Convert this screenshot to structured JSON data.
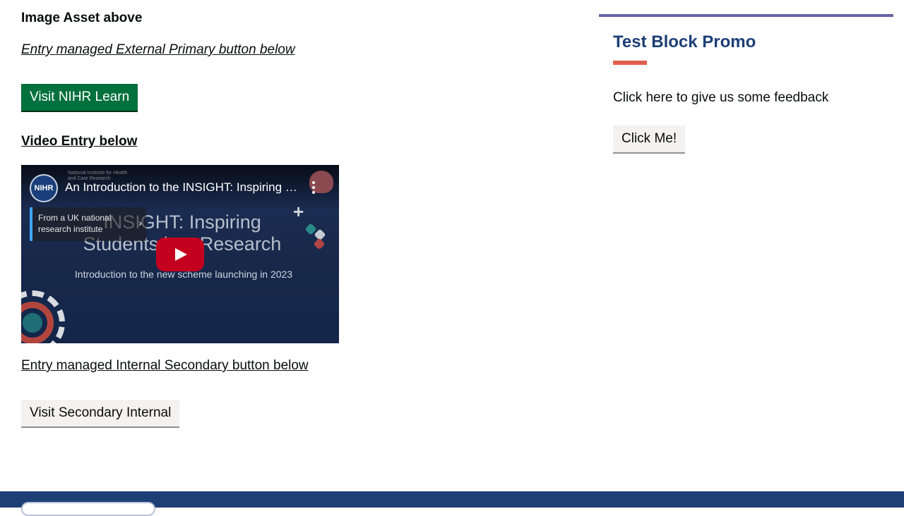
{
  "main": {
    "image_asset_text": "Image Asset above",
    "external_link_text": "Entry managed External Primary button below",
    "primary_button_label": "Visit NIHR Learn",
    "video_link_text": "Video Entry below",
    "internal_link_text": "Entry managed Internal Secondary button below",
    "secondary_button_label": "Visit Secondary Internal"
  },
  "video": {
    "channel_avatar_text": "NIHR",
    "title": "An Introduction to the INSIGHT: Inspiring Students into Research",
    "info_card_text": "From a UK national research institute",
    "heading": "INSIGHT: Inspiring Students into Research",
    "subtitle": "Introduction to the new scheme launching in 2023",
    "banner_logo_text": "National Institute for Health and Care Research"
  },
  "promo": {
    "title": "Test Block Promo",
    "text": "Click here to give us some feedback",
    "button_label": "Click Me!"
  },
  "colors": {
    "primary_button": "#00703c",
    "promo_border": "#6565a4",
    "promo_title": "#1d3f75",
    "promo_accent": "#e05e4e",
    "footer": "#1d3f75"
  },
  "icons": {
    "play": "play-icon",
    "more": "kebab-menu-icon",
    "chevron": "chevron-right-icon"
  }
}
